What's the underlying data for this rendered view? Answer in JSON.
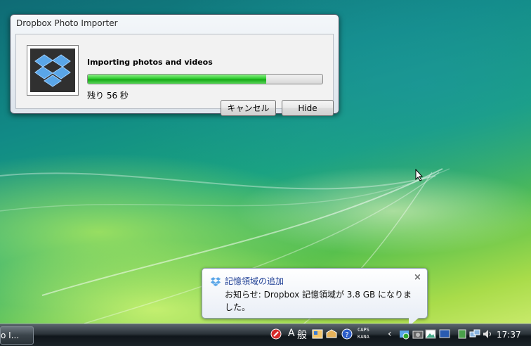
{
  "dialog": {
    "title": "Dropbox Photo Importer",
    "heading": "Importing photos and videos",
    "progress_fraction": 0.76,
    "time_left": "残り 56 秒",
    "cancel_label": "キャンセル",
    "hide_label": "Hide",
    "logo_icon": "dropbox-logo-icon"
  },
  "notification": {
    "title": "記憶領域の追加",
    "message": "お知らせ: Dropbox 記憶領域が 3.8 GB になりました。",
    "close_glyph": "×",
    "icon": "dropbox-icon"
  },
  "taskbar": {
    "task_button_label": "o I...",
    "ime_mode": "A",
    "ime_kanji": "般",
    "caps_label": "CAPS",
    "kana_label": "KANA",
    "overflow_glyph": "‹",
    "clock": "17:37"
  },
  "colors": {
    "progress_green": "#16a716",
    "balloon_title": "#1f3f95",
    "dropbox_blue": "#5aa6e8"
  }
}
